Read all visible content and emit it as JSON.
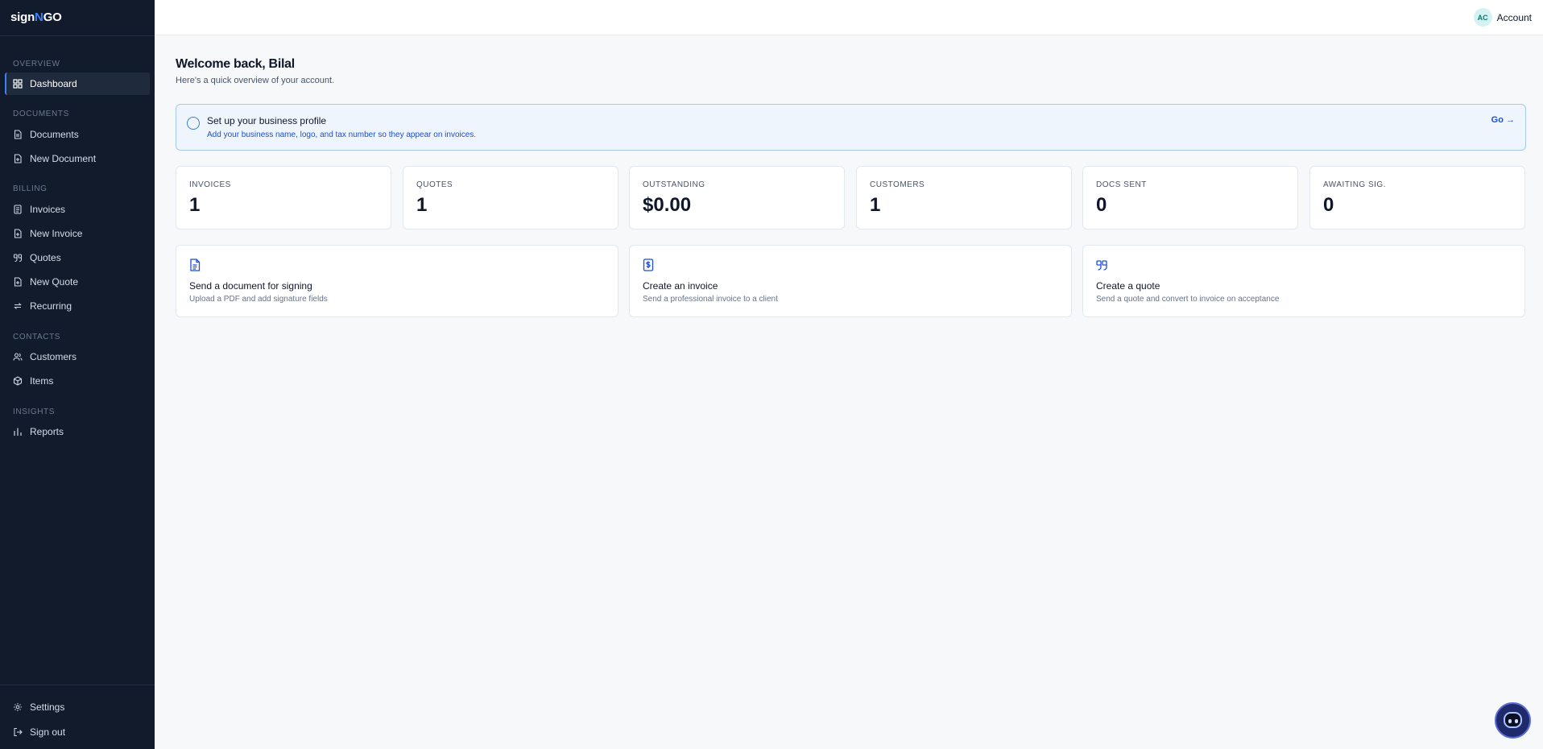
{
  "brand": {
    "name_prefix": "sign",
    "name_accent": "N",
    "name_suffix": "GO"
  },
  "header": {
    "account": {
      "initials": "AC",
      "label": "Account"
    }
  },
  "sidebar": {
    "sections": [
      {
        "label": "OVERVIEW",
        "items": [
          {
            "label": "Dashboard",
            "icon": "grid-icon",
            "active": true
          }
        ]
      },
      {
        "label": "DOCUMENTS",
        "items": [
          {
            "label": "Documents",
            "icon": "file-text-icon"
          },
          {
            "label": "New Document",
            "icon": "file-plus-icon"
          }
        ]
      },
      {
        "label": "BILLING",
        "items": [
          {
            "label": "Invoices",
            "icon": "receipt-icon"
          },
          {
            "label": "New Invoice",
            "icon": "file-plus-icon"
          },
          {
            "label": "Quotes",
            "icon": "quote-icon"
          },
          {
            "label": "New Quote",
            "icon": "file-plus-icon"
          },
          {
            "label": "Recurring",
            "icon": "repeat-icon"
          }
        ]
      },
      {
        "label": "CONTACTS",
        "items": [
          {
            "label": "Customers",
            "icon": "users-icon"
          },
          {
            "label": "Items",
            "icon": "package-icon"
          }
        ]
      },
      {
        "label": "INSIGHTS",
        "items": [
          {
            "label": "Reports",
            "icon": "bar-chart-icon"
          }
        ]
      }
    ],
    "footer": [
      {
        "label": "Settings",
        "icon": "gear-icon"
      },
      {
        "label": "Sign out",
        "icon": "logout-icon"
      }
    ]
  },
  "main": {
    "welcome": "Welcome back, Bilal",
    "subtitle": "Here's a quick overview of your account.",
    "banner": {
      "title": "Set up your business profile",
      "description": "Add your business name, logo, and tax number so they appear on invoices.",
      "go_label": "Go →"
    },
    "stats": [
      {
        "label": "INVOICES",
        "value": "1"
      },
      {
        "label": "QUOTES",
        "value": "1"
      },
      {
        "label": "OUTSTANDING",
        "value": "$0.00"
      },
      {
        "label": "CUSTOMERS",
        "value": "1"
      },
      {
        "label": "DOCS SENT",
        "value": "0"
      },
      {
        "label": "AWAITING SIG.",
        "value": "0"
      }
    ],
    "actions": [
      {
        "title": "Send a document for signing",
        "description": "Upload a PDF and add signature fields",
        "icon": "file-text-icon"
      },
      {
        "title": "Create an invoice",
        "description": "Send a professional invoice to a client",
        "icon": "receipt-icon"
      },
      {
        "title": "Create a quote",
        "description": "Send a quote and convert to invoice on acceptance",
        "icon": "quote-icon"
      }
    ]
  },
  "colors": {
    "sidebar_bg": "#111b2c",
    "accent": "#3b82f6",
    "link": "#1d4ed8",
    "banner_bg": "#eef5fc"
  }
}
